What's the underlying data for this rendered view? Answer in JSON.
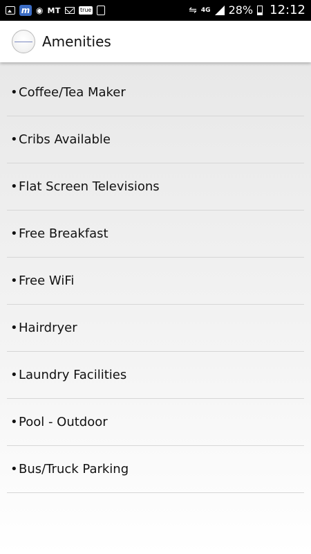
{
  "status_bar": {
    "carrier_text": "MT",
    "true_badge": "true",
    "network": "4G",
    "battery": "28%",
    "time": "12:12"
  },
  "app_bar": {
    "title": "Amenities"
  },
  "amenities": [
    {
      "bullet": "•",
      "label": "Coffee/Tea Maker"
    },
    {
      "bullet": "•",
      "label": "Cribs Available"
    },
    {
      "bullet": "•",
      "label": "Flat Screen Televisions"
    },
    {
      "bullet": "•",
      "label": "Free Breakfast"
    },
    {
      "bullet": "•",
      "label": "Free WiFi"
    },
    {
      "bullet": "•",
      "label": "Hairdryer"
    },
    {
      "bullet": "•",
      "label": "Laundry Facilities"
    },
    {
      "bullet": "•",
      "label": "Pool - Outdoor"
    },
    {
      "bullet": "•",
      "label": "Bus/Truck Parking"
    }
  ],
  "colors": {
    "status_bar_bg": "#000000",
    "app_bar_bg": "#ffffff",
    "list_bg_top": "#e8e8e8",
    "list_bg_bottom": "#ffffff",
    "divider": "#d6d6d6"
  }
}
